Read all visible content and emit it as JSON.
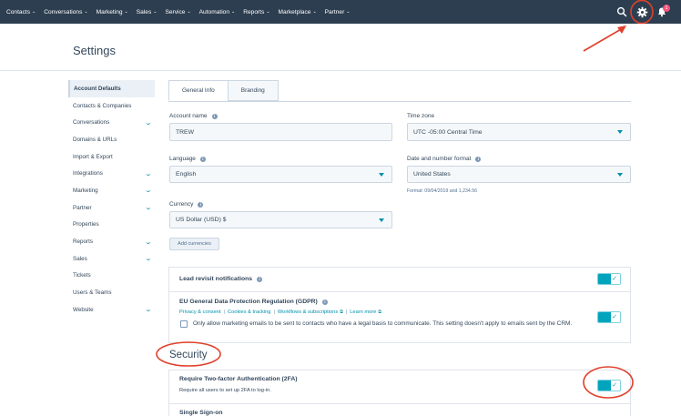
{
  "topnav": {
    "items": [
      {
        "label": "Contacts"
      },
      {
        "label": "Conversations"
      },
      {
        "label": "Marketing"
      },
      {
        "label": "Sales"
      },
      {
        "label": "Service"
      },
      {
        "label": "Automation"
      },
      {
        "label": "Reports"
      },
      {
        "label": "Marketplace"
      },
      {
        "label": "Partner"
      }
    ],
    "icons": [
      "search-icon",
      "gear-icon",
      "bell-icon"
    ],
    "notification_count": "1",
    "colors": {
      "bar": "#2d3e50",
      "badge": "#f2547d"
    }
  },
  "page": {
    "title": "Settings"
  },
  "sidebar": {
    "items": [
      {
        "label": "Account Defaults",
        "active": true,
        "expandable": false
      },
      {
        "label": "Contacts & Companies",
        "expandable": false
      },
      {
        "label": "Conversations",
        "expandable": true
      },
      {
        "label": "Domains & URLs",
        "expandable": false
      },
      {
        "label": "Import & Export",
        "expandable": false
      },
      {
        "label": "Integrations",
        "expandable": true
      },
      {
        "label": "Marketing",
        "expandable": true
      },
      {
        "label": "Partner",
        "expandable": true
      },
      {
        "label": "Properties",
        "expandable": false
      },
      {
        "label": "Reports",
        "expandable": true
      },
      {
        "label": "Sales",
        "expandable": true
      },
      {
        "label": "Tickets",
        "expandable": false
      },
      {
        "label": "Users & Teams",
        "expandable": false
      },
      {
        "label": "Website",
        "expandable": true
      }
    ]
  },
  "tabs": [
    {
      "label": "General Info",
      "active": true
    },
    {
      "label": "Branding",
      "active": false
    }
  ],
  "form": {
    "account_name": {
      "label": "Account name",
      "value": "TREW"
    },
    "time_zone": {
      "label": "Time zone",
      "value": "UTC -05:00 Central Time"
    },
    "language": {
      "label": "Language",
      "value": "English"
    },
    "date_format": {
      "label": "Date and number format",
      "value": "United States",
      "hint": "Format: 09/04/2019 and 1,234.56"
    },
    "currency": {
      "label": "Currency",
      "value": "US Dollar (USD) $"
    },
    "add_currencies": "Add currencies"
  },
  "notifications": {
    "lead_revisit": {
      "title": "Lead revisit notifications",
      "enabled": true
    },
    "gdpr": {
      "title": "EU General Data Protection Regulation (GDPR)",
      "links": [
        "Privacy & consent",
        "Cookies & tracking",
        "Workflows & subscriptions",
        "Learn more"
      ],
      "checkbox_text": "Only allow marketing emails to be sent to contacts who have a legal basis to communicate. This setting doesn't apply to emails sent by the CRM.",
      "checked": false,
      "enabled": true
    }
  },
  "security": {
    "title": "Security",
    "two_factor": {
      "title": "Require Two-factor Authentication (2FA)",
      "desc": "Require all users to set up 2FA to log-in.",
      "enabled": true
    },
    "sso": {
      "title": "Single Sign-on"
    }
  },
  "accent_color": "#00a4bd",
  "annotation_color": "#e0402b"
}
